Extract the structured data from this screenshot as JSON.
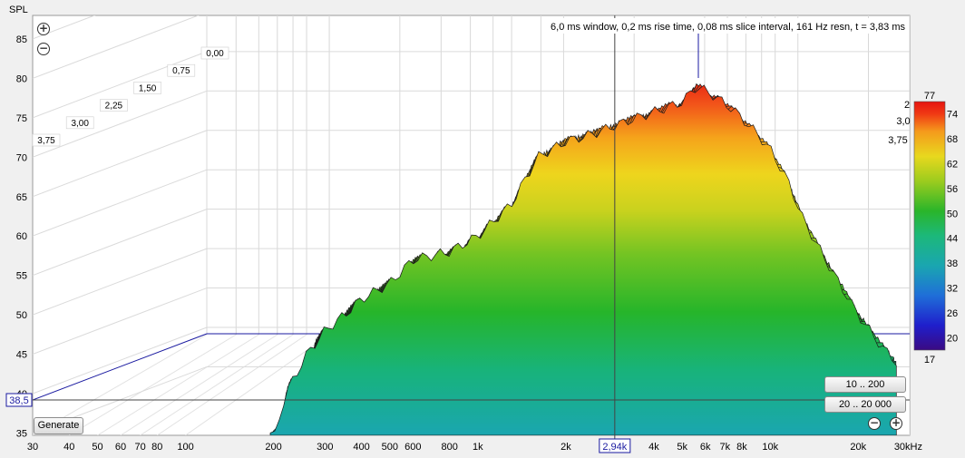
{
  "chart_data": {
    "type": "waterfall",
    "title": "6,0 ms window, 0,2 ms rise time, 0,08 ms slice interval, 161 Hz resn, t = 3,83 ms",
    "ylabel": "SPL",
    "xlabel_unit": "kHz",
    "x_scale": "log",
    "xlim": [
      30,
      30000
    ],
    "ylim": [
      35,
      87
    ],
    "x_ticks": [
      "30",
      "40",
      "50",
      "60",
      "70",
      "80",
      "100",
      "200",
      "300",
      "400",
      "500",
      "600",
      "800",
      "1k",
      "2k",
      "4k",
      "5k",
      "6k",
      "7k",
      "8k",
      "10k",
      "20k",
      "30kHz"
    ],
    "x_tick_values": [
      30,
      40,
      50,
      60,
      70,
      80,
      100,
      200,
      300,
      400,
      500,
      600,
      800,
      1000,
      2000,
      4000,
      5000,
      6000,
      7000,
      8000,
      10000,
      20000,
      30000
    ],
    "y_ticks": [
      "85",
      "80",
      "75",
      "70",
      "65",
      "60",
      "55",
      "50",
      "45",
      "40",
      "35"
    ],
    "time_ticks_left": [
      "3,75",
      "3,00",
      "2,25",
      "1,50",
      "0,75",
      "0,00"
    ],
    "time_ticks_right": [
      "2",
      "3,0",
      "3,75"
    ],
    "cursor": {
      "x_label": "2,94k",
      "x": 2940,
      "y_label": "38,5",
      "y": 38.5
    },
    "colorscale": {
      "max_label": "77",
      "min_label": "17",
      "ticks": [
        "74",
        "68",
        "62",
        "56",
        "50",
        "44",
        "38",
        "32",
        "26",
        "20"
      ],
      "colors": [
        "#3a0a82",
        "#1f1fcc",
        "#1f6fd8",
        "#1aa6b0",
        "#1cb87a",
        "#2ab52a",
        "#9ccc1e",
        "#e8d81e",
        "#f59a1c",
        "#f03a14",
        "#e61410"
      ]
    },
    "grid": true,
    "slices": 47,
    "time_range_ms": [
      0,
      3.83
    ],
    "envelope_first_slice_db": [
      [
        200,
        34
      ],
      [
        220,
        40
      ],
      [
        260,
        45
      ],
      [
        300,
        48
      ],
      [
        350,
        50
      ],
      [
        400,
        52
      ],
      [
        500,
        54
      ],
      [
        600,
        57
      ],
      [
        800,
        58
      ],
      [
        1000,
        60
      ],
      [
        1300,
        64
      ],
      [
        1600,
        70
      ],
      [
        2000,
        72
      ],
      [
        2500,
        73
      ],
      [
        2940,
        74
      ],
      [
        3500,
        75
      ],
      [
        4200,
        76
      ],
      [
        5000,
        77
      ],
      [
        5600,
        79
      ],
      [
        6300,
        78
      ],
      [
        7500,
        76
      ],
      [
        9000,
        73
      ],
      [
        10000,
        71
      ],
      [
        11500,
        67
      ],
      [
        13000,
        62
      ],
      [
        16000,
        56
      ],
      [
        20000,
        50
      ],
      [
        24000,
        46
      ],
      [
        27000,
        44
      ]
    ]
  },
  "controls": {
    "generate_label": "Generate",
    "range_btn_1": "10 .. 200",
    "range_btn_2": "20 .. 20 000",
    "zoom_in_glyph": "+",
    "zoom_out_glyph": "−"
  },
  "icons": [
    "zoom-in-icon",
    "zoom-out-icon"
  ]
}
